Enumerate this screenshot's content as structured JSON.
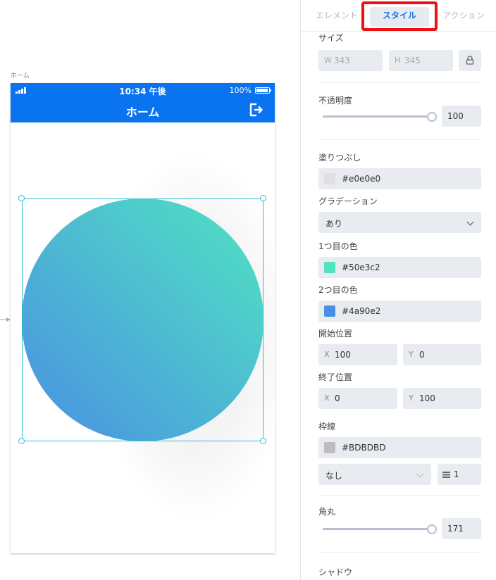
{
  "canvas": {
    "frame_label": "ホーム",
    "status_bar": {
      "time": "10:34 午後",
      "battery": "100%"
    },
    "nav_bar": {
      "title": "ホーム",
      "action_icon": "logout-icon"
    },
    "shape": {
      "type": "circle",
      "fill_start": "#50e3c2",
      "fill_end": "#4a90e2",
      "corner_radius": 171
    }
  },
  "inspector": {
    "tabs": [
      {
        "label": "エレメント",
        "active": false
      },
      {
        "label": "スタイル",
        "active": true
      },
      {
        "label": "アクション",
        "active": false
      }
    ],
    "size": {
      "label": "サイズ",
      "w_prefix": "W",
      "w": "343",
      "h_prefix": "H",
      "h": "345",
      "lock_icon": "lock-icon"
    },
    "opacity": {
      "label": "不透明度",
      "value": "100"
    },
    "fill": {
      "label": "塗りつぶし",
      "color": "#e0e0e0",
      "value": "#e0e0e0"
    },
    "gradient": {
      "label": "グラデーション",
      "selected": "あり"
    },
    "color1": {
      "label": "1つ目の色",
      "color": "#50e3c2",
      "value": "#50e3c2"
    },
    "color2": {
      "label": "2つ目の色",
      "color": "#4a90e2",
      "value": "#4a90e2"
    },
    "start_pos": {
      "label": "開始位置",
      "x_prefix": "X",
      "x": "100",
      "y_prefix": "Y",
      "y": "0"
    },
    "end_pos": {
      "label": "終了位置",
      "x_prefix": "X",
      "x": "0",
      "y_prefix": "Y",
      "y": "100"
    },
    "border": {
      "label": "枠線",
      "color": "#BDBDBD",
      "value": "#BDBDBD",
      "style": "なし",
      "width": "1"
    },
    "radius": {
      "label": "角丸",
      "value": "171"
    },
    "shadow": {
      "label": "シャドウ"
    }
  }
}
